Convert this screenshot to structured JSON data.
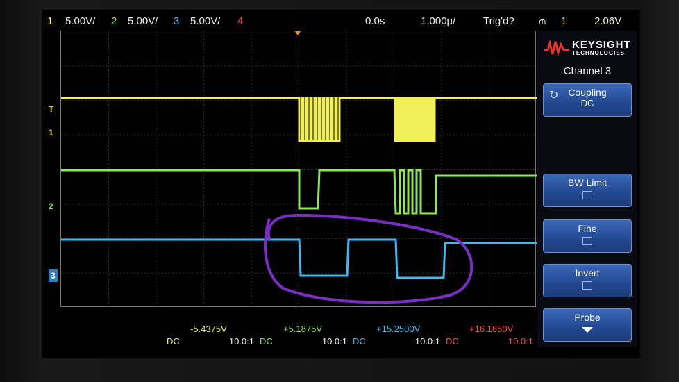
{
  "top_bar": {
    "ch1_num": "1",
    "ch1_scale": "5.00V/",
    "ch2_num": "2",
    "ch2_scale": "5.00V/",
    "ch3_num": "3",
    "ch3_scale": "5.00V/",
    "ch4_num": "4",
    "time_offset": "0.0s",
    "time_scale": "1.000µ/",
    "trigger_status": "Trig'd?",
    "trigger_icon": "⫙",
    "trigger_source": "1",
    "trigger_level": "2.06V"
  },
  "screen": {
    "trigger_marker": "T",
    "ch1_marker": "1",
    "ch2_marker": "2",
    "ch3_marker": "3"
  },
  "channels": [
    {
      "coupling": "DC",
      "offset": "-5.4375V",
      "probe": "10.0:1",
      "color": "#f2f05a"
    },
    {
      "coupling": "DC",
      "offset": "+5.1875V",
      "probe": "10.0:1",
      "color": "#8ee65a"
    },
    {
      "coupling": "DC",
      "offset": "+15.2500V",
      "probe": "10.0:1",
      "color": "#3db8f0"
    },
    {
      "coupling": "DC",
      "offset": "+16.1850V",
      "probe": "10.0:1",
      "color": "#ff4a4a"
    }
  ],
  "panel": {
    "brand": "KEYSIGHT",
    "brand_sub": "TECHNOLOGIES",
    "menu_title": "Channel 3",
    "coupling_label": "Coupling",
    "coupling_value": "DC",
    "bw_limit_label": "BW Limit",
    "fine_label": "Fine",
    "invert_label": "Invert",
    "probe_label": "Probe"
  },
  "colors": {
    "ch1": "#f2f05a",
    "ch2": "#8ee65a",
    "ch3": "#3db8f0",
    "ch4": "#ff4a4a",
    "annotation": "#7a2fc4",
    "accent": "#ff8c1a"
  }
}
